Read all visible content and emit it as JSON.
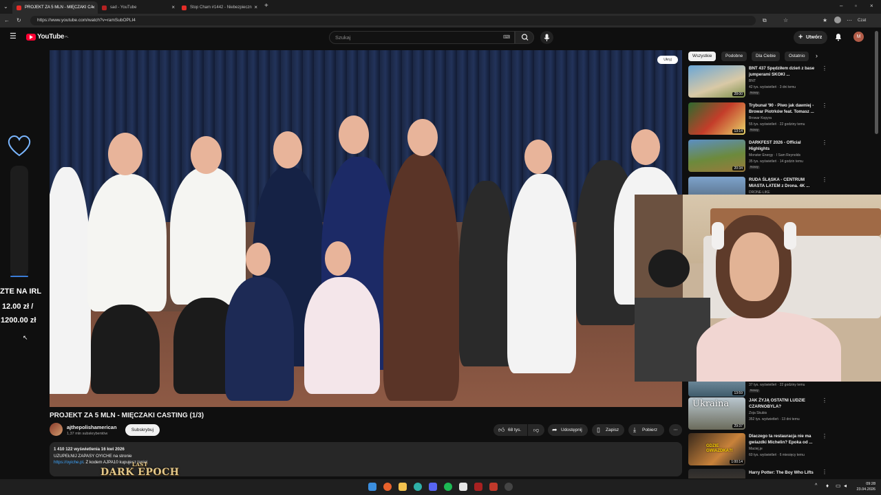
{
  "browser": {
    "tabs": [
      {
        "title": "PROJEKT ZA 5 MLN - MIĘCZAKI CA",
        "active": true
      },
      {
        "title": "sad - YouTube",
        "active": false
      },
      {
        "title": "Stop Cham #1442 - Niebezpieczn",
        "active": false
      }
    ],
    "url": "https://www.youtube.com/watch?v=ramSubOPLI4",
    "profile_label": "Czat"
  },
  "youtube": {
    "logo_text": "YouTube",
    "logo_region": "PL",
    "search_placeholder": "Szukaj",
    "create_label": "Utwórz",
    "avatar_letter": "M"
  },
  "video": {
    "hide_label": "Ukryj",
    "title": "PROJEKT ZA 5 MLN - MIĘCZAKI CASTING (1/3)",
    "channel_name": "ajthepolishamerican",
    "channel_subs": "1,37 mln subskrybentów",
    "subscribe_label": "Subskrybuj",
    "likes": "68 tys.",
    "share_label": "Udostępnij",
    "save_label": "Zapisz",
    "download_label": "Pobierz",
    "description": {
      "stats": "1 410 122 wyświetlenia  16 kwi 2026",
      "line1": "UZUPEŁNIJ ZAPASY OYICHE na stronie",
      "link": "https://oyiche.pl",
      "line2": ". Z kodem AJPA10 kupujesz taniej"
    }
  },
  "overlay": {
    "donate_title": "ZTE NA IRL",
    "donate_current": "12.00 zł /",
    "donate_goal": "1200.00 zł",
    "donate_progress": 0.01,
    "game_logo": "DARK EPOCH",
    "game_logo_top": "LAST"
  },
  "sidebar": {
    "chips": [
      "Wszystkie",
      "Podobne",
      "Dla Ciebie",
      "Ostatnio"
    ],
    "recommendations": [
      {
        "title": "BNT 437 Spędziłem dzień z base jumperami SKOKI ...",
        "channel": "BNT",
        "meta": "42 tys. wyświetleń · 3 dni temu",
        "badge": "Nowy",
        "duration": "28:00"
      },
      {
        "title": "Trybunał '90 - Piwo jak dawniej - Browar Piotrków feat. Tomasz ...",
        "channel": "Browar Kopyra",
        "meta": "55 tys. wyświetleń · 22 godziny temu",
        "badge": "Nowy",
        "duration": "13:14"
      },
      {
        "title": "DARKFEST 2026 - Official Highlights",
        "channel": "Monster Energy · I Sam Reynolds",
        "meta": "35 tys. wyświetleń · 14 godzin temu",
        "badge": "Nowy",
        "duration": "20:34"
      },
      {
        "title": "RUDA ŚLĄSKA - CENTRUM MIASTA LATEM z Drona. 4K ...",
        "channel": "DRONE-LIKE",
        "meta": "",
        "badge": "",
        "duration": ""
      },
      {
        "title": "",
        "channel": "",
        "meta": "37 tys. wyświetleń · 22 godziny temu",
        "badge": "Nowy",
        "duration": "13:59"
      },
      {
        "title": "JAK ŻYJĄ OSTATNI LUDZIE CZARNOBYLA?",
        "channel": "Zoja Skubis",
        "meta": "352 tys. wyświetleń · 13 dni temu",
        "badge": "",
        "duration": "29:37",
        "thumb_text": "Ukraina"
      },
      {
        "title": "Dlaczego ta restauracja nie ma gwiazdki Michelin? Epoka od ...",
        "channel": "Maciej.je",
        "meta": "60 tys. wyświetleń · 6 miesięcy temu",
        "badge": "",
        "duration": "1:00:14",
        "thumb_text": "GDZIE GWIAZDKA?!"
      },
      {
        "title": "Harry Potter: The Boy Who Lifts",
        "channel": "",
        "meta": "",
        "badge": "",
        "duration": ""
      }
    ]
  },
  "taskbar": {
    "time": "09:28",
    "date": "23.04.2026"
  },
  "colors": {
    "accent_red": "#ff0033",
    "background": "#0f0f0f",
    "link": "#3ea6ff"
  }
}
